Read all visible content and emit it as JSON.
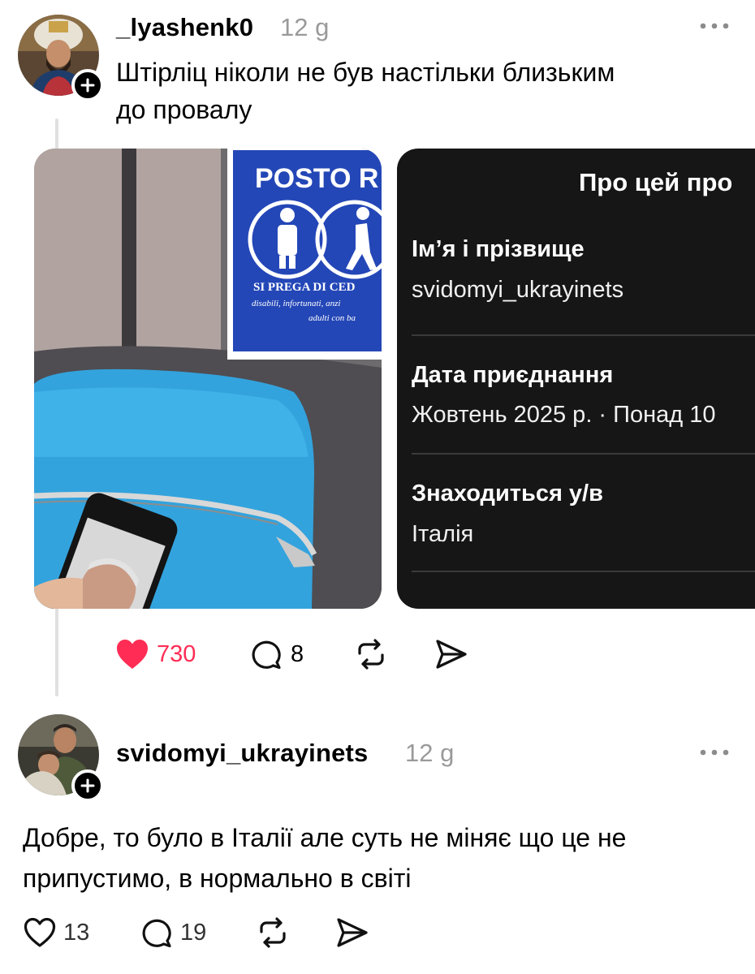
{
  "post": {
    "username": "_lyashenk0",
    "time": "12 g",
    "text_line1": "Штірліц ніколи не був настільки близьким",
    "text_line2": "до провалу",
    "photo_sign": {
      "title": "POSTO R",
      "line1": "SI PREGA DI CED",
      "line2": "disabili, infortunati, anzi",
      "line3": "adulti con ba"
    },
    "profile_card": {
      "title": "Про цей про",
      "name_label": "Ім’я і прізвище",
      "name_value": "svidomyi_ukrayinets",
      "joined_label": "Дата приєднання",
      "joined_value": "Жовтень 2025 р. · Понад 10",
      "location_label": "Знаходиться у/в",
      "location_value": "Італія"
    },
    "likes": "730",
    "comments": "8",
    "like_color": "#ff2d55"
  },
  "reply": {
    "username": "svidomyi_ukrayinets",
    "time": "12 g",
    "text_line1": "Добре, то було в Італії але суть не міняє що це не",
    "text_line2": "припустимо, в нормально в світі",
    "likes": "13",
    "comments": "19"
  },
  "icons": {
    "more": "more-horizontal-icon",
    "plus": "plus-icon",
    "like": "heart-icon",
    "comment": "comment-bubble-icon",
    "repost": "repost-icon",
    "share": "send-icon"
  }
}
